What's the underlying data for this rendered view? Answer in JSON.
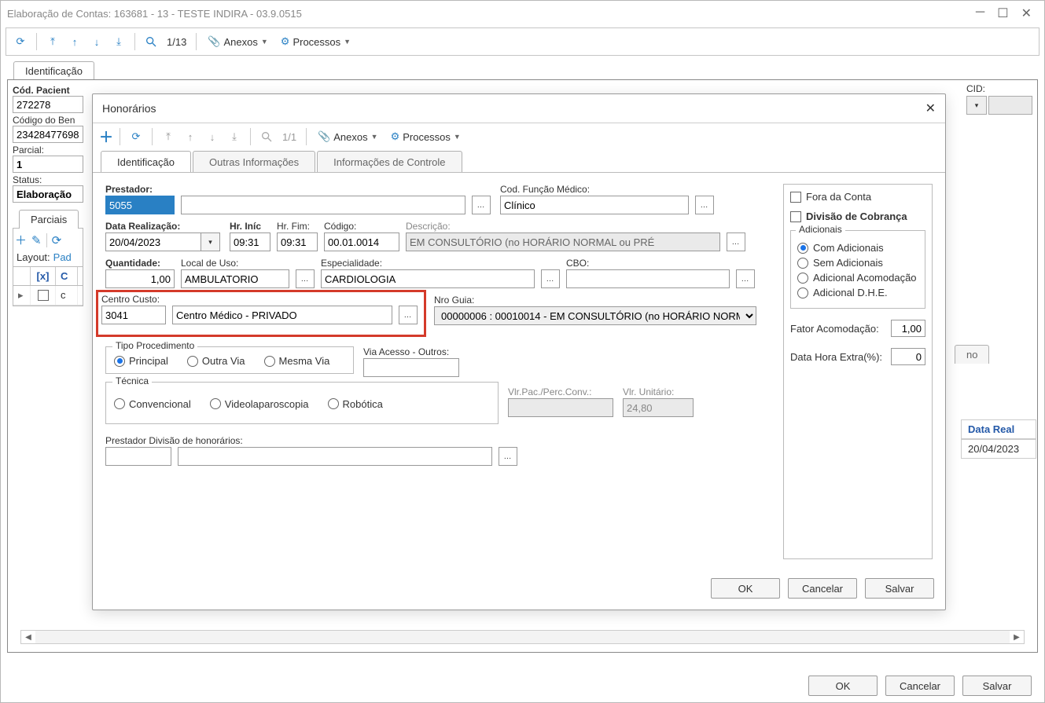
{
  "window": {
    "title": "Elaboração de Contas: 163681 - 13 - TESTE INDIRA - 03.9.0515",
    "minimize": "─",
    "maximize": "☐",
    "close": "✕"
  },
  "main_toolbar": {
    "page_indicator": "1/13",
    "anexos": "Anexos",
    "processos": "Processos"
  },
  "main_tabs": {
    "identificacao": "Identificação"
  },
  "bg_form": {
    "cod_paciente_label": "Cód. Pacient",
    "cod_paciente_value": "272278",
    "codigo_benef_label": "Código do Ben",
    "codigo_benef_value": "23428477698",
    "parcial_label": "Parcial:",
    "parcial_value": "1",
    "status_label": "Status:",
    "status_value": "Elaboração",
    "cid_label": "CID:"
  },
  "bg_sub_tabs": {
    "parciais": "Parciais",
    "no": "no"
  },
  "bg_layout": {
    "layout_label": "Layout:",
    "pad": "Pad"
  },
  "bg_grid": {
    "col_x": "[x]",
    "col_c": "C",
    "row1_c": "c",
    "col_data_real": "Data Real",
    "row1_data": "20/04/2023"
  },
  "modal": {
    "title": "Honorários",
    "toolbar_page": "1/1",
    "toolbar_anexos": "Anexos",
    "toolbar_processos": "Processos",
    "tabs": {
      "identificacao": "Identificação",
      "outras": "Outras Informações",
      "controle": "Informações de Controle"
    },
    "prestador_label": "Prestador:",
    "prestador_code": "5055",
    "prestador_name": "",
    "cod_funcao_label": "Cod. Função Médico:",
    "cod_funcao_value": "Clínico",
    "data_realizacao_label": "Data Realização:",
    "data_realizacao_value": "20/04/2023",
    "hr_inic_label": "Hr. Iníc",
    "hr_inic_value": "09:31",
    "hr_fim_label": "Hr. Fim:",
    "hr_fim_value": "09:31",
    "codigo_label": "Código:",
    "codigo_value": "00.01.0014",
    "descricao_label": "Descrição:",
    "descricao_value": "EM CONSULTÓRIO (no HORÁRIO NORMAL ou PRÉ",
    "quantidade_label": "Quantidade:",
    "quantidade_value": "1,00",
    "local_uso_label": "Local de Uso:",
    "local_uso_value": "AMBULATORIO",
    "especialidade_label": "Especialidade:",
    "especialidade_value": "CARDIOLOGIA",
    "cbo_label": "CBO:",
    "cbo_value": "",
    "centro_custo_label": "Centro Custo:",
    "centro_custo_code": "3041",
    "centro_custo_name": "Centro Médico - PRIVADO",
    "nro_guia_label": "Nro Guia:",
    "nro_guia_value": "00000006 : 00010014 - EM CONSULTÓRIO (no HORÁRIO NORM…",
    "tipo_proc_legend": "Tipo Procedimento",
    "tipo_proc_principal": "Principal",
    "tipo_proc_outra": "Outra Via",
    "tipo_proc_mesma": "Mesma Via",
    "via_acesso_label": "Via Acesso - Outros:",
    "tecnica_legend": "Técnica",
    "tecnica_conv": "Convencional",
    "tecnica_video": "Videolaparoscopia",
    "tecnica_robo": "Robótica",
    "vlr_pac_label": "Vlr.Pac./Perc.Conv.:",
    "vlr_unit_label": "Vlr. Unitário:",
    "vlr_unit_value": "24,80",
    "prest_div_label": "Prestador Divisão de honorários:",
    "fora_conta": "Fora da Conta",
    "div_cobranca": "Divisão de Cobrança",
    "adicionais_legend": "Adicionais",
    "adic_com": "Com Adicionais",
    "adic_sem": "Sem Adicionais",
    "adic_acom": "Adicional Acomodação",
    "adic_dhe": "Adicional D.H.E.",
    "fator_acom_label": "Fator Acomodação:",
    "fator_acom_value": "1,00",
    "data_hora_label": "Data Hora Extra(%):",
    "data_hora_value": "0",
    "btn_ok": "OK",
    "btn_cancelar": "Cancelar",
    "btn_salvar": "Salvar"
  },
  "main_footer": {
    "ok": "OK",
    "cancelar": "Cancelar",
    "salvar": "Salvar"
  }
}
